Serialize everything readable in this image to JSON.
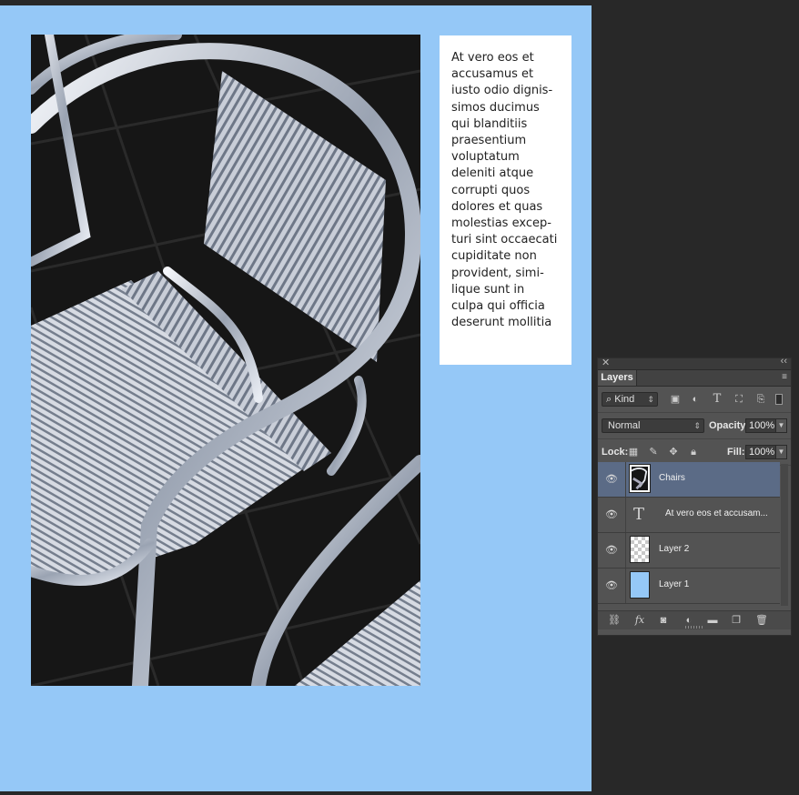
{
  "document": {
    "background_color": "#95c8f7",
    "text_frame": {
      "body": "At vero eos et\naccusamus et\niusto odio dignis-\nsimos ducimus\nqui blanditiis\npraesentium\nvoluptatum\ndeleniti atque\ncorrupti quos\ndolores et quas\nmolestias excep-\nturi sint occaecati\ncupiditate non\nprovident, simi-\nlique sunt in\nculpa qui officia\ndeserunt mollitia"
    }
  },
  "layers_panel": {
    "close_glyph": "✕",
    "collapse_glyph": "‹‹",
    "tab_label": "Layers",
    "menu_glyph": "≡",
    "filter": {
      "value": "Kind",
      "icons": [
        "image-filter-icon",
        "adjustment-filter-icon",
        "type-filter-icon",
        "shape-filter-icon",
        "smart-object-filter-icon"
      ]
    },
    "blend_mode": "Normal",
    "opacity_label": "Opacity:",
    "opacity_value": "100%",
    "lock_label": "Lock:",
    "fill_label": "Fill:",
    "fill_value": "100%",
    "layers": [
      {
        "name": "Chairs",
        "type": "image",
        "visible": true,
        "selected": true
      },
      {
        "name": "At vero eos et accusam...",
        "type": "text",
        "visible": true,
        "selected": false
      },
      {
        "name": "Layer 2",
        "type": "transparent",
        "visible": true,
        "selected": false
      },
      {
        "name": "Layer 1",
        "type": "fill",
        "visible": true,
        "selected": false
      }
    ],
    "type_glyph": "T",
    "selected_color": "#5b6b86"
  }
}
